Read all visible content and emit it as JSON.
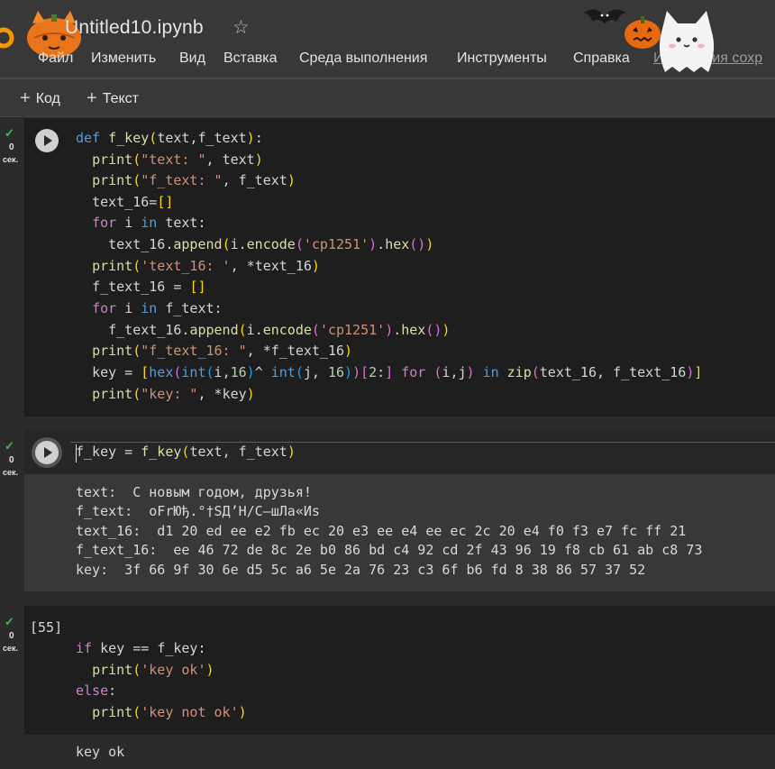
{
  "notebook": {
    "title": "Untitled10.ipynb",
    "star_icon": "star-icon"
  },
  "menu": {
    "file": "Файл",
    "edit": "Изменить",
    "view": "Вид",
    "insert": "Вставка",
    "runtime": "Среда выполнения",
    "tools": "Инструменты",
    "help": "Справка",
    "changes": "Изменения сохр"
  },
  "toolbar": {
    "code_label": "Код",
    "text_label": "Текст",
    "plus": "+"
  },
  "cells": [
    {
      "status": {
        "check": "✓",
        "seconds": "0",
        "unit": "сек."
      }
    },
    {
      "status": {
        "check": "✓",
        "seconds": "0",
        "unit": "сек."
      },
      "output": [
        "text:  С новым годом, друзья!",
        "f_text:  оFrЮђ.°†SД’Н/С–шЛа«Иs",
        "text_16:  d1 20 ed ee e2 fb ec 20 e3 ee e4 ee ec 2c 20 e4 f0 f3 e7 fc ff 21",
        "f_text_16:  ee 46 72 de 8c 2e b0 86 bd c4 92 cd 2f 43 96 19 f8 cb 61 ab c8 73",
        "key:  3f 66 9f 30 6e d5 5c a6 5e 2a 76 23 c3 6f b6 fd 8 38 86 57 37 52"
      ]
    },
    {
      "status": {
        "check": "✓",
        "seconds": "0",
        "unit": "сек."
      },
      "execution_count": "[55]",
      "output": [
        "key ok"
      ]
    }
  ],
  "colors": {
    "keyword": "#569cd6",
    "control": "#c586c0",
    "function": "#dcdcaa",
    "string": "#ce9178",
    "number": "#b5cea8",
    "success": "#3fb950"
  }
}
